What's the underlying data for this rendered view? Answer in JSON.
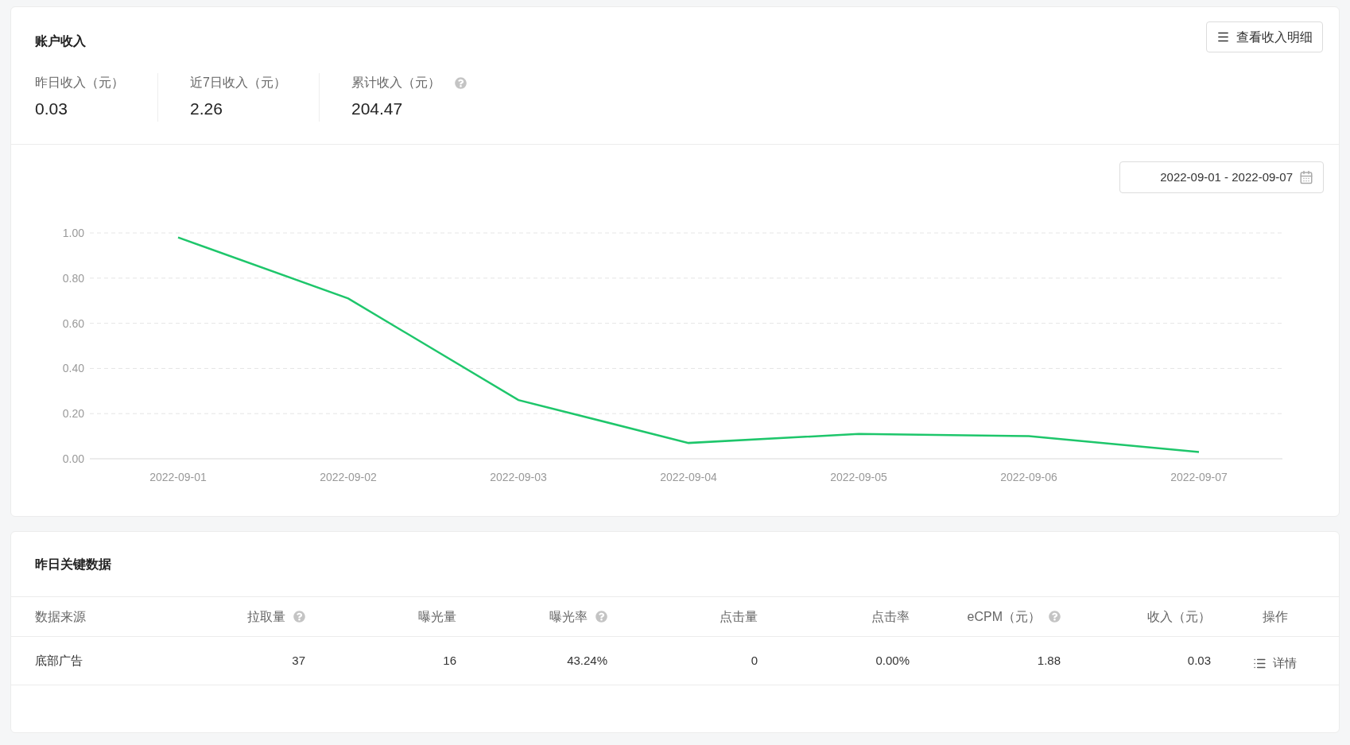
{
  "income_card": {
    "title": "账户收入",
    "detail_button": "查看收入明细",
    "stats": [
      {
        "label": "昨日收入（元）",
        "value": "0.03",
        "help": false
      },
      {
        "label": "近7日收入（元）",
        "value": "2.26",
        "help": false
      },
      {
        "label": "累计收入（元）",
        "value": "204.47",
        "help": true
      }
    ],
    "date_range": "2022-09-01 - 2022-09-07",
    "chart_data": {
      "type": "line",
      "categories": [
        "2022-09-01",
        "2022-09-02",
        "2022-09-03",
        "2022-09-04",
        "2022-09-05",
        "2022-09-06",
        "2022-09-07"
      ],
      "grid": true,
      "series": [
        {
          "color": "#1ec66b",
          "values": [
            0.98,
            0.71,
            0.26,
            0.07,
            0.11,
            0.1,
            0.03
          ]
        }
      ],
      "ylim": [
        0,
        1
      ],
      "yticks": [
        {
          "value": 0,
          "label": "0.00"
        },
        {
          "value": 0.2,
          "label": "0.20"
        },
        {
          "value": 0.4,
          "label": "0.40"
        },
        {
          "value": 0.6,
          "label": "0.60"
        },
        {
          "value": 0.8,
          "label": "0.80"
        },
        {
          "value": 1,
          "label": "1.00"
        }
      ]
    }
  },
  "key_data_card": {
    "title": "昨日关键数据",
    "table": {
      "columns": [
        {
          "label": "数据来源",
          "help": false
        },
        {
          "label": "拉取量",
          "help": true
        },
        {
          "label": "曝光量",
          "help": false
        },
        {
          "label": "曝光率",
          "help": true
        },
        {
          "label": "点击量",
          "help": false
        },
        {
          "label": "点击率",
          "help": false
        },
        {
          "label": "eCPM（元）",
          "help": true
        },
        {
          "label": "收入（元）",
          "help": false
        },
        {
          "label": "操作",
          "help": false
        }
      ],
      "rows": [
        {
          "cells": [
            "底部广告",
            "37",
            "16",
            "43.24%",
            "0",
            "0.00%",
            "1.88",
            "0.03"
          ],
          "action": "详情"
        }
      ]
    }
  }
}
